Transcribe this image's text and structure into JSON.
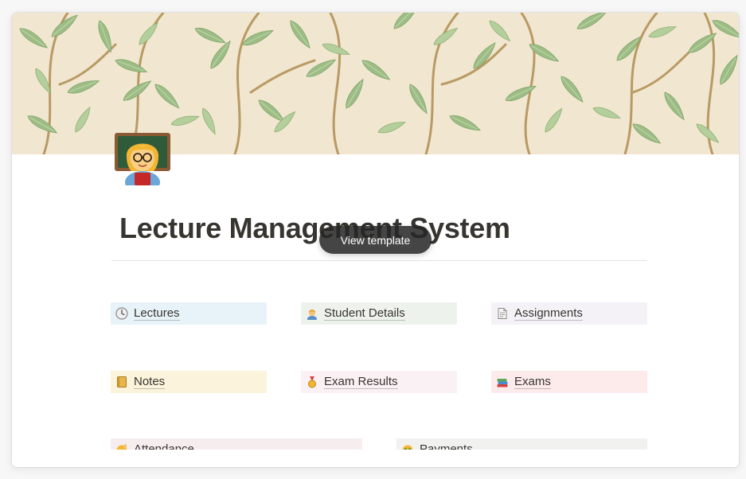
{
  "page": {
    "title": "Lecture Management System",
    "view_template_label": "View template",
    "page_icon": "teacher-emoji"
  },
  "links": [
    {
      "label": "Lectures",
      "icon": "clock-icon",
      "bg": "#e7f3f8"
    },
    {
      "label": "Student Details",
      "icon": "student-icon",
      "bg": "#edf3ec"
    },
    {
      "label": "Assignments",
      "icon": "document-icon",
      "bg": "#f4f2f7"
    },
    {
      "label": "Notes",
      "icon": "notebook-icon",
      "bg": "#fbf3db"
    },
    {
      "label": "Exam Results",
      "icon": "medal-icon",
      "bg": "#faf1f5"
    },
    {
      "label": "Exams",
      "icon": "books-icon",
      "bg": "#fdebec"
    },
    {
      "label": "Attendance",
      "icon": "raising-hand-icon",
      "bg": "#f6eeee"
    },
    {
      "label": "Payments",
      "icon": "money-face-icon",
      "bg": "#f1f1ef"
    }
  ],
  "colors": {
    "text": "#37352f",
    "cover_bg": "#f1e6cf",
    "leaf": "#9dbd85",
    "branch": "#b89a64"
  }
}
